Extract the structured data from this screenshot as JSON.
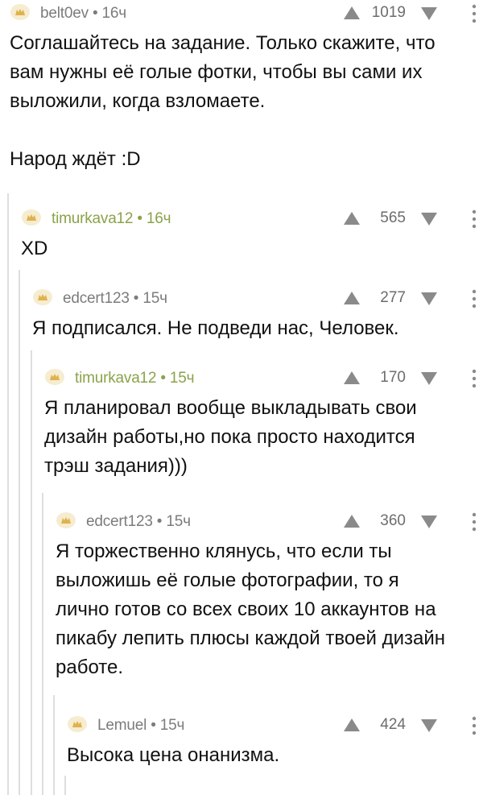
{
  "comments": [
    {
      "author": "belt0ev",
      "time": "16ч",
      "rating": "1019",
      "author_color": "grey",
      "lines": [
        "Соглашайтесь на задание. Только скажите, что",
        "вам нужны её голые фотки, чтобы вы сами их",
        "выложили, когда взломаете."
      ],
      "extra": "Народ ждёт :D"
    },
    {
      "author": "timurkava12",
      "time": "16ч",
      "rating": "565",
      "author_color": "green",
      "lines": [
        "XD"
      ]
    },
    {
      "author": "edcert123",
      "time": "15ч",
      "rating": "277",
      "author_color": "grey",
      "lines": [
        "Я подписался. Не подведи нас, Человек."
      ]
    },
    {
      "author": "timurkava12",
      "time": "15ч",
      "rating": "170",
      "author_color": "green",
      "lines": [
        "Я планировал вообще выкладывать свои",
        "дизайн работы,но пока просто находится",
        "трэш задания)))"
      ]
    },
    {
      "author": "edcert123",
      "time": "15ч",
      "rating": "360",
      "author_color": "grey",
      "lines": [
        "Я торжественно клянусь, что если ты",
        "выложишь её голые фотографии, то я",
        "лично готов со всех своих 10 аккаунтов на",
        "пикабу лепить плюсы каждой твоей дизайн",
        "работе."
      ]
    },
    {
      "author": "Lemuel",
      "time": "15ч",
      "rating": "424",
      "author_color": "grey",
      "lines": [
        "Высока цена онанизма."
      ]
    }
  ],
  "separator": " • ",
  "colors": {
    "author_grey": "#7c7c7c",
    "author_green": "#8aa34a",
    "thread_line": "#dedede",
    "icon": "#8a8a8a"
  },
  "icons": {
    "avatar": "default-avatar-icon",
    "upvote": "arrow-up-icon",
    "downvote": "arrow-down-icon",
    "more": "more-dots-icon"
  }
}
